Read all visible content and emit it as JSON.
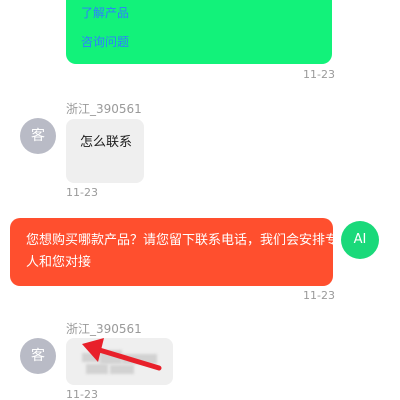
{
  "messages": {
    "bot_links": {
      "link_1": "了解产品",
      "link_2": "咨询问题"
    },
    "time_1": "11-23",
    "user_1": {
      "username": "浙江_390561",
      "avatar_label": "客",
      "text": "怎么联系",
      "time": "11-23"
    },
    "bot_reply": {
      "avatar_label": "AI",
      "line_1": "您想购买哪款产品？请您留下联系电话，我们会安排专",
      "line_2": "人和您对接",
      "time": "11-23"
    },
    "user_2": {
      "username": "浙江_390561",
      "avatar_label": "客",
      "time": "11-23"
    }
  },
  "colors": {
    "bot_bubble": "#12f27a",
    "reply_bubble": "#ff4f2e",
    "ai_avatar": "#1ad97a",
    "customer_avatar": "#b9bbc6",
    "annotation_arrow": "#e8202a"
  }
}
